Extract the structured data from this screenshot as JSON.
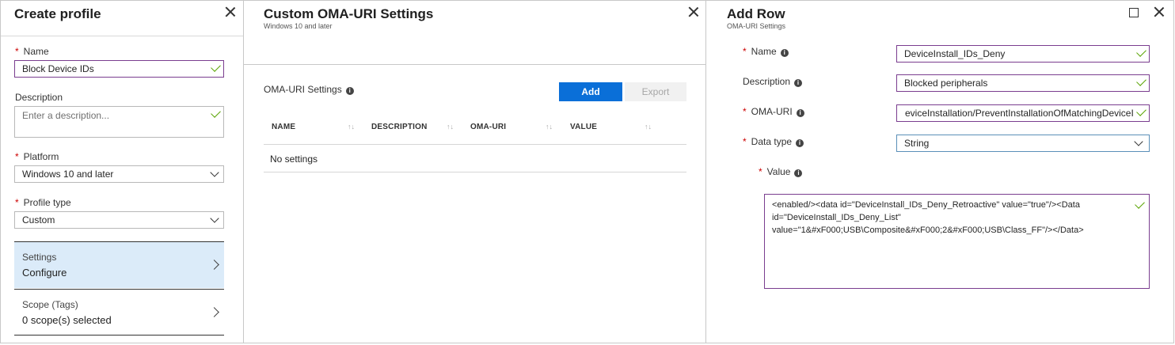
{
  "create_profile": {
    "title": "Create profile",
    "name_label": "Name",
    "name_value": "Block Device IDs",
    "description_label": "Description",
    "description_placeholder": "Enter a description...",
    "platform_label": "Platform",
    "platform_value": "Windows 10 and later",
    "profile_type_label": "Profile type",
    "profile_type_value": "Custom",
    "settings_item": {
      "label": "Settings",
      "value": "Configure"
    },
    "scope_item": {
      "label": "Scope (Tags)",
      "value": "0 scope(s) selected"
    }
  },
  "oma_settings": {
    "title": "Custom OMA-URI Settings",
    "subtitle": "Windows 10 and later",
    "section_label": "OMA-URI Settings",
    "add_label": "Add",
    "export_label": "Export",
    "columns": [
      "NAME",
      "DESCRIPTION",
      "OMA-URI",
      "VALUE"
    ],
    "empty_text": "No settings"
  },
  "add_row": {
    "title": "Add Row",
    "subtitle": "OMA-URI Settings",
    "name_label": "Name",
    "name_value": "DeviceInstall_IDs_Deny",
    "description_label": "Description",
    "description_value": "Blocked peripherals",
    "oma_uri_label": "OMA-URI",
    "oma_uri_value": "eviceInstallation/PreventInstallationOfMatchingDeviceI",
    "data_type_label": "Data type",
    "data_type_value": "String",
    "value_label": "Value",
    "value_text": "<enabled/><data id=\"DeviceInstall_IDs_Deny_Retroactive\" value=\"true\"/><Data id=\"DeviceInstall_IDs_Deny_List\" value=\"1&#xF000;USB\\Composite&#xF000;2&#xF000;USB\\Class_FF\"/></Data>"
  },
  "colors": {
    "accent_blue": "#0a6fd8",
    "valid_border": "#7a3d8f",
    "check_green": "#57a300",
    "selected_bg": "#dbebf9",
    "required_red": "#cc0000"
  }
}
